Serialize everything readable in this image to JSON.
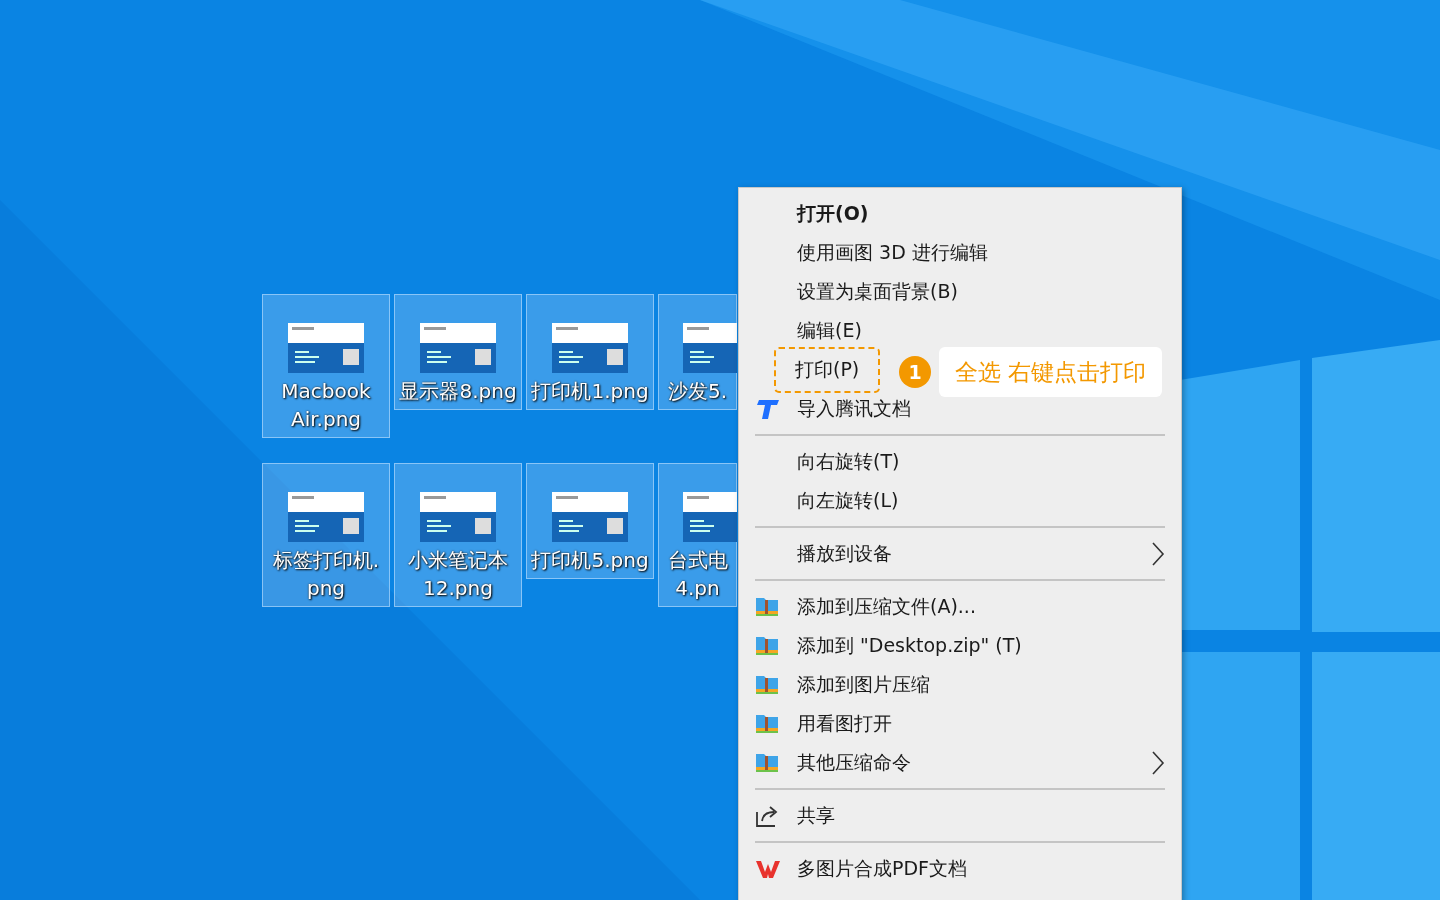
{
  "desktop_icons": [
    {
      "lines": [
        "Macbook",
        "Air.png"
      ],
      "selected": true,
      "kind": "full"
    },
    {
      "lines": [
        "显示器8.png"
      ],
      "selected": true,
      "kind": "full"
    },
    {
      "lines": [
        "打印机1.png"
      ],
      "selected": true,
      "kind": "full"
    },
    {
      "lines": [
        "沙发5."
      ],
      "selected": true,
      "kind": "partial"
    },
    {
      "lines": [
        "标签打印机.",
        "png"
      ],
      "selected": true,
      "kind": "full"
    },
    {
      "lines": [
        "小米笔记本",
        "12.png"
      ],
      "selected": true,
      "kind": "full"
    },
    {
      "lines": [
        "打印机5.png"
      ],
      "selected": true,
      "kind": "full"
    },
    {
      "lines": [
        "台式电",
        "4.pn"
      ],
      "selected": true,
      "kind": "partial"
    }
  ],
  "context_menu": {
    "items": [
      {
        "kind": "plain",
        "label": "打开(O)",
        "default": true,
        "submenu": false
      },
      {
        "kind": "plain",
        "label": "使用画图 3D 进行编辑",
        "default": false,
        "submenu": false
      },
      {
        "kind": "plain",
        "label": "设置为桌面背景(B)",
        "default": false,
        "submenu": false
      },
      {
        "kind": "plain",
        "label": "编辑(E)",
        "default": false,
        "submenu": false
      },
      {
        "kind": "plain",
        "label": "打印(P)",
        "default": false,
        "submenu": false,
        "callout": {
          "step": "1",
          "text": "全选 右键点击打印"
        }
      },
      {
        "kind": "tencent",
        "label": "导入腾讯文档",
        "default": false,
        "submenu": false
      },
      {
        "kind": "separator"
      },
      {
        "kind": "plain",
        "label": "向右旋转(T)",
        "default": false,
        "submenu": false
      },
      {
        "kind": "plain",
        "label": "向左旋转(L)",
        "default": false,
        "submenu": false
      },
      {
        "kind": "separator"
      },
      {
        "kind": "plain",
        "label": "播放到设备",
        "default": false,
        "submenu": true
      },
      {
        "kind": "separator"
      },
      {
        "kind": "archive",
        "label": "添加到压缩文件(A)...",
        "default": false,
        "submenu": false
      },
      {
        "kind": "archive",
        "label": "添加到 \"Desktop.zip\" (T)",
        "default": false,
        "submenu": false
      },
      {
        "kind": "archive",
        "label": "添加到图片压缩",
        "default": false,
        "submenu": false
      },
      {
        "kind": "archive",
        "label": "用看图打开",
        "default": false,
        "submenu": false
      },
      {
        "kind": "archive",
        "label": "其他压缩命令",
        "default": false,
        "submenu": true
      },
      {
        "kind": "separator"
      },
      {
        "kind": "share",
        "label": "共享",
        "default": false,
        "submenu": false
      },
      {
        "kind": "separator"
      },
      {
        "kind": "wps",
        "label": "多图片合成PDF文档",
        "default": false,
        "submenu": false
      }
    ]
  }
}
